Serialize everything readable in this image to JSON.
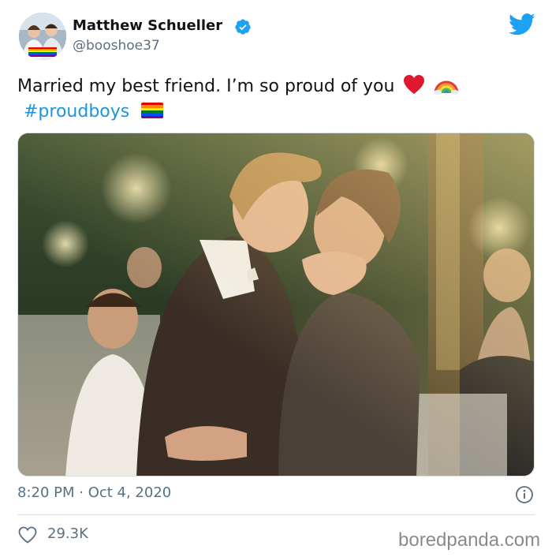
{
  "author": {
    "display_name": "Matthew Schueller",
    "handle": "@booshoe37",
    "verified": true,
    "avatar": "profile-photo"
  },
  "tweet": {
    "text": "Married my best friend. I’m so proud of you",
    "emojis": [
      "red-heart",
      "rainbow"
    ],
    "hashtag": "#proudboys",
    "hashtag_emoji": "rainbow-flag",
    "image": "wedding-kiss-photo",
    "time": "8:20 PM · Oct 4, 2020",
    "likes": "29.3K"
  },
  "icons": {
    "brand": "twitter-bird-icon",
    "info": "info-icon",
    "like": "heart-icon"
  },
  "colors": {
    "link": "#1b95e0",
    "muted": "#5b7083",
    "verified": "#1da1f2",
    "heart_emoji": "#e0182d"
  },
  "watermark": "boredpanda.com"
}
